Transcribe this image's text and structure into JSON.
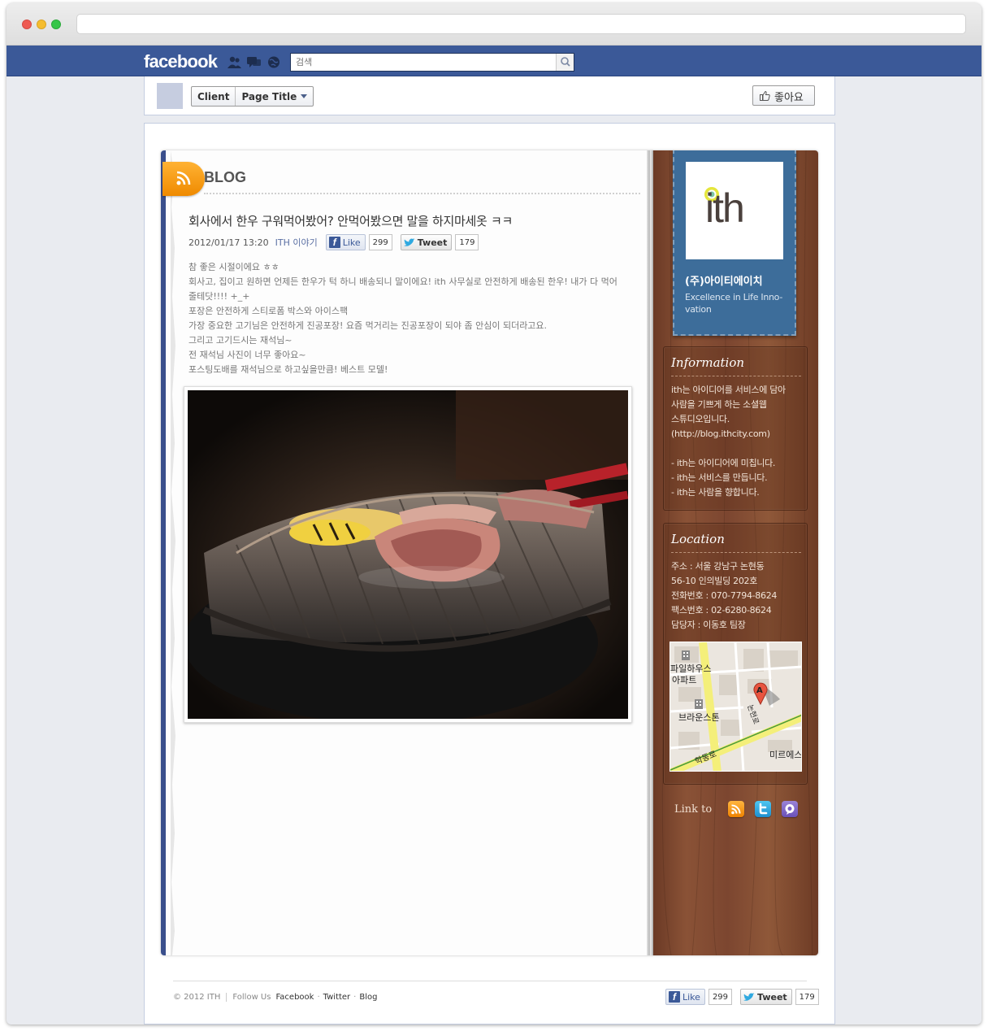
{
  "browser": {
    "url": ""
  },
  "facebook": {
    "logo": "facebook",
    "search_placeholder": "검색",
    "jewels": [
      "friends-icon",
      "messages-icon",
      "notifications-icon"
    ]
  },
  "page_header": {
    "crumb_client": "Client",
    "crumb_page": "Page Title",
    "like_label": "좋아요"
  },
  "blog": {
    "section_title": "BLOG",
    "post": {
      "title": "회사에서 한우 구워먹어봤어? 안먹어봤으면 말을 하지마세옷 ㅋㅋ",
      "date": "2012/01/17 13:20",
      "category": "ITH 이야기",
      "like_label": "Like",
      "like_count": "299",
      "tweet_label": "Tweet",
      "tweet_count": "179",
      "body": [
        "참 좋은 시절이에요 ㅎㅎ",
        "회사고, 집이고 원하면 언제든 한우가 턱 하니 배송되니 말이에요! ith 사무실로 안전하게 배송된 한우! 내가 다 먹어 줄테닷!!!! +_+",
        "포장은 안전하게 스티로폼 박스와 아이스팩",
        "가장 중요한 고기님은 안전하게 진공포장! 요즘 먹거리는 진공포장이 되야 좀 안심이 되더라고요.",
        "그리고 고기드시는 재석님~",
        "전 재석님 사진이 너무 좋아요~",
        "포스팅도배를 재석님으로 하고싶을만큼! 베스트 모델!"
      ]
    }
  },
  "sidebar": {
    "logo_text": "ith",
    "company_name": "(주)아이티에이치",
    "slogan": "Excellence in Life Inno-vation",
    "information": {
      "heading": "Information",
      "lines": [
        "ith는 아이디어를 서비스에 담아",
        "사람을 기쁘게 하는 소셜웹",
        "스튜디오입니다.",
        "(http://blog.ithcity.com)",
        "",
        "- ith는 아이디어에 미칩니다.",
        "- ith는 서비스를 만듭니다.",
        "- ith는 사람을 향합니다."
      ]
    },
    "location": {
      "heading": "Location",
      "lines": [
        "주소 : 서울 강남구 논현동",
        "56-10 인의빌딩 202호",
        "전화번호 : 070-7794-8624",
        "팩스번호 : 02-6280-8624",
        "담당자 : 이동호 팀장"
      ],
      "map_labels": {
        "apt1": "파일하우스",
        "apt1b": "아파트",
        "apt2": "브라운스톤",
        "road": "학동로",
        "road2": "논현로",
        "mire": "미르에스",
        "marker": "A"
      }
    },
    "link_to": "Link to"
  },
  "footer": {
    "copyright": "© 2012 ITH",
    "follow_us": "Follow Us",
    "links": [
      "Facebook",
      "Twitter",
      "Blog"
    ],
    "like_label": "Like",
    "like_count": "299",
    "tweet_label": "Tweet",
    "tweet_count": "179"
  },
  "colors": {
    "facebook_blue": "#3b5998",
    "rss_orange": "#f39a14",
    "ribbon_blue": "#3d6d9a",
    "wood_brown": "#7c4630"
  }
}
